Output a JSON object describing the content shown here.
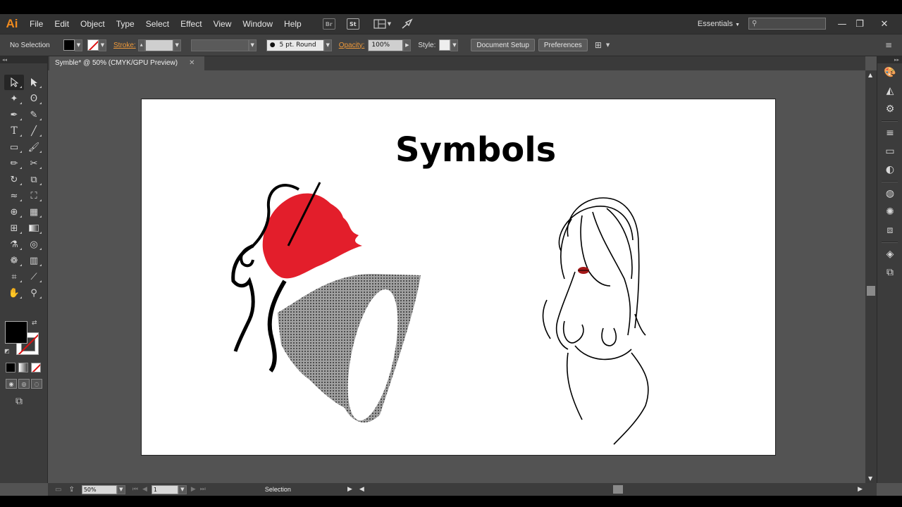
{
  "app": {
    "logo": "Ai"
  },
  "menu": [
    "File",
    "Edit",
    "Object",
    "Type",
    "Select",
    "Effect",
    "View",
    "Window",
    "Help"
  ],
  "menu_icons": {
    "br": "Br",
    "st": "St"
  },
  "workspace": {
    "label": "Essentials"
  },
  "window_controls": {
    "minimize": "—",
    "restore": "❐",
    "close": "✕"
  },
  "control": {
    "selection": "No Selection",
    "stroke_label": "Stroke:",
    "brush": "5 pt. Round",
    "opacity_label": "Opacity:",
    "opacity_value": "100%",
    "style_label": "Style:",
    "doc_setup": "Document Setup",
    "preferences": "Preferences"
  },
  "tab": {
    "title": "Symble* @ 50% (CMYK/GPU Preview)",
    "close": "✕"
  },
  "artboard": {
    "title": "Symbols"
  },
  "status": {
    "zoom": "50%",
    "page": "1",
    "tool": "Selection"
  },
  "colors": {
    "accent_orange": "#f08a1e",
    "hair_red": "#e31e2b",
    "lips_red": "#a51818"
  }
}
